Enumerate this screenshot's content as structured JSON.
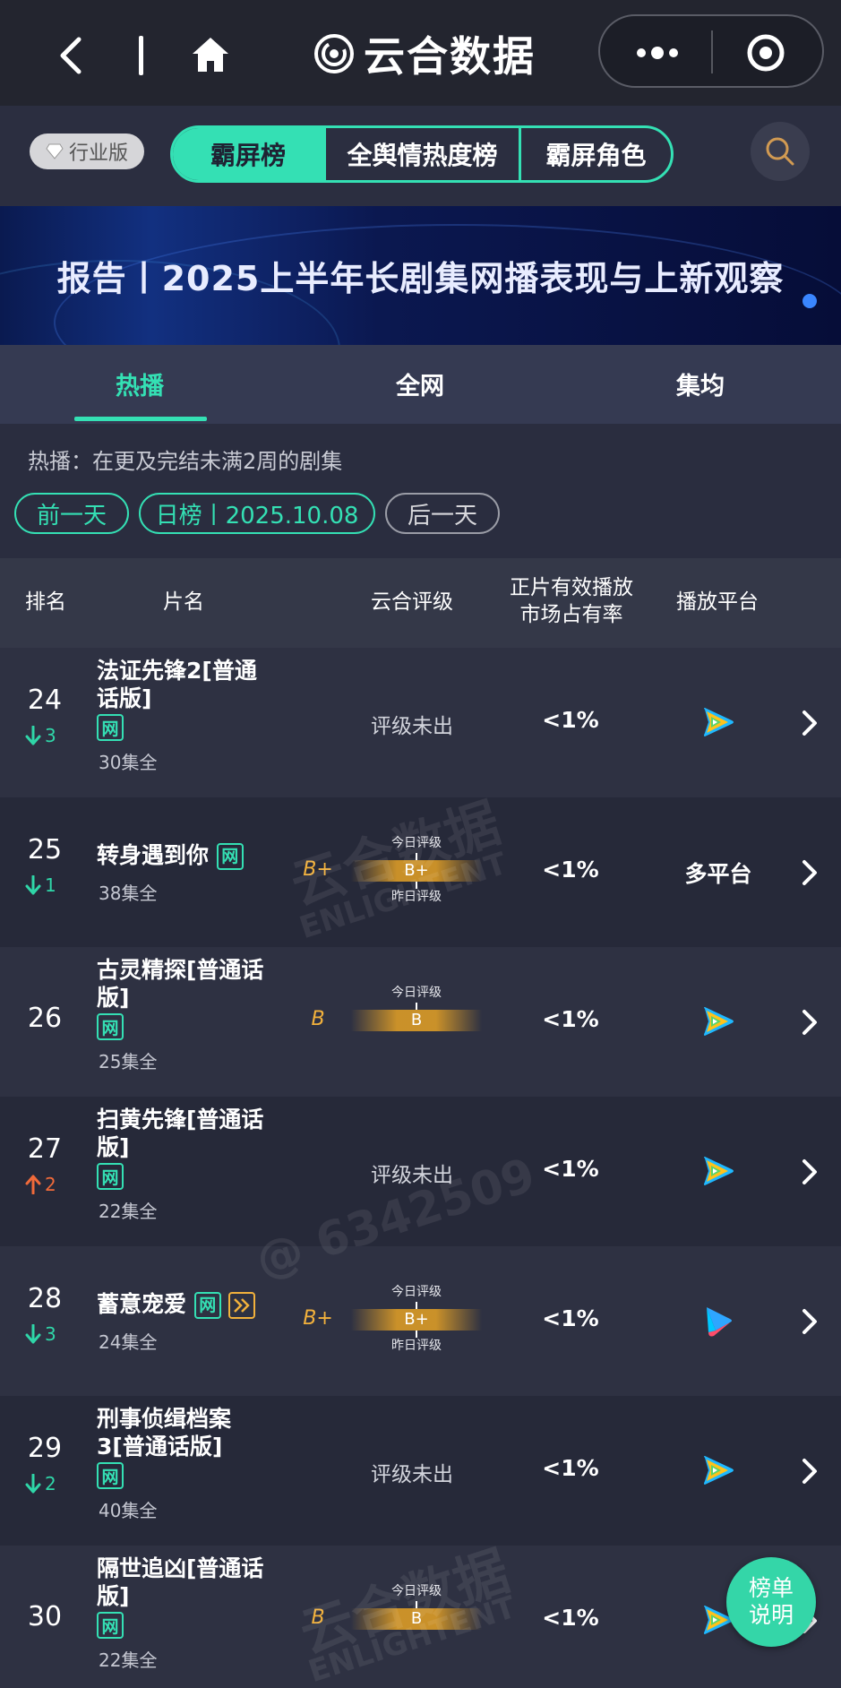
{
  "nav": {
    "brand": "云合数据"
  },
  "tabbar": {
    "industry_badge": "行业版",
    "segments": [
      "霸屏榜",
      "全舆情热度榜",
      "霸屏角色"
    ]
  },
  "banner": {
    "title": "报告丨2025上半年长剧集网播表现与上新观察"
  },
  "subtabs": [
    "热播",
    "全网",
    "集均"
  ],
  "info": {
    "description": "热播：在更及完结未满2周的剧集",
    "prev_day": "前一天",
    "date_label": "日榜丨2025.10.08",
    "next_day": "后一天"
  },
  "table_header": {
    "rank": "排名",
    "title": "片名",
    "rating": "云合评级",
    "share_line1": "正片有效播放",
    "share_line2": "市场占有率",
    "platform": "播放平台"
  },
  "rows": [
    {
      "rank": "24",
      "change": "3",
      "direction": "down",
      "title": "法证先锋2[普通话版]",
      "tags": [
        "网"
      ],
      "episodes": "30集全",
      "rating": "评级未出",
      "share": "<1%",
      "platform_icon": "tencent-video-icon"
    },
    {
      "rank": "25",
      "change": "1",
      "direction": "down",
      "title": "转身遇到你",
      "tags": [
        "网"
      ],
      "episodes": "38集全",
      "grade": "B+",
      "today_label": "今日评级",
      "bar_value": "B+",
      "yesterday_label": "昨日评级",
      "share": "<1%",
      "platform_text": "多平台"
    },
    {
      "rank": "26",
      "title": "古灵精探[普通话版]",
      "tags": [
        "网"
      ],
      "episodes": "25集全",
      "grade": "B",
      "today_label": "今日评级",
      "bar_value": "B",
      "share": "<1%",
      "platform_icon": "tencent-video-icon"
    },
    {
      "rank": "27",
      "change": "2",
      "direction": "up",
      "title": "扫黄先锋[普通话版]",
      "tags": [
        "网"
      ],
      "episodes": "22集全",
      "rating": "评级未出",
      "share": "<1%",
      "platform_icon": "tencent-video-icon"
    },
    {
      "rank": "28",
      "change": "3",
      "direction": "down",
      "title": "蓄意宠爱",
      "tags": [
        "网"
      ],
      "episodes": "24集全",
      "grade": "B+",
      "today_label": "今日评级",
      "bar_value": "B+",
      "yesterday_label": "昨日评级",
      "share": "<1%",
      "platform_icon": "youku-icon"
    },
    {
      "rank": "29",
      "change": "2",
      "direction": "down",
      "title": "刑事侦缉档案3[普通话版]",
      "tags": [
        "网"
      ],
      "episodes": "40集全",
      "rating": "评级未出",
      "share": "<1%",
      "platform_icon": "tencent-video-icon"
    },
    {
      "rank": "30",
      "title": "隔世追凶[普通话版]",
      "tags": [
        "网"
      ],
      "episodes": "22集全",
      "grade": "B",
      "today_label": "今日评级",
      "bar_value": "B",
      "share": "<1%",
      "platform_icon": "tencent-video-icon"
    }
  ],
  "fab": {
    "line1": "榜单",
    "line2": "说明"
  },
  "watermarks": [
    "云合数据",
    "ENLIGHTENT",
    "@ 6342509",
    "云合数据",
    "ENLIGHTENT"
  ]
}
